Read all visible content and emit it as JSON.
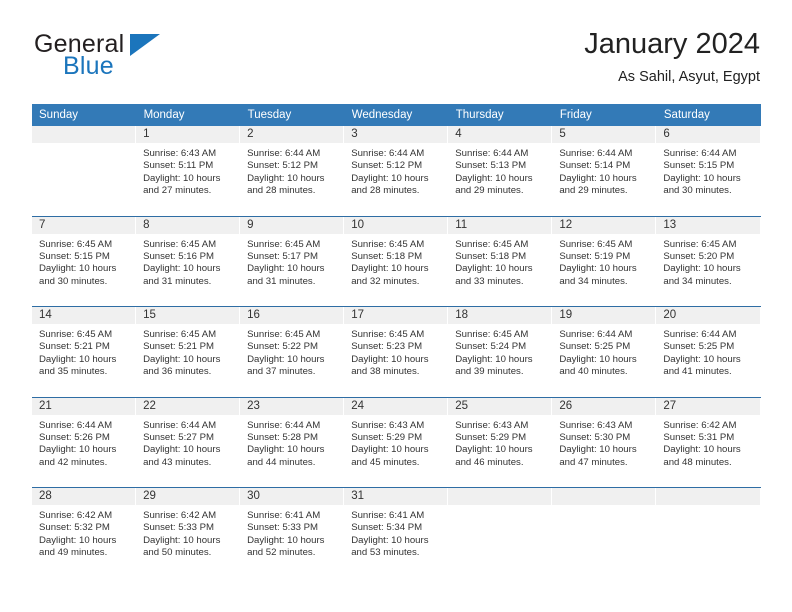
{
  "brand": {
    "name_top": "General",
    "name_bottom": "Blue",
    "accent_color": "#1b75bc"
  },
  "header": {
    "title": "January 2024",
    "subtitle": "As Sahil, Asyut, Egypt"
  },
  "theme": {
    "header_row_bg": "#337ab7",
    "daynum_bg": "#f0f0f0",
    "row_separator": "#2e6da4",
    "text_color": "#333333"
  },
  "weekday_headers": [
    "Sunday",
    "Monday",
    "Tuesday",
    "Wednesday",
    "Thursday",
    "Friday",
    "Saturday"
  ],
  "labels": {
    "sunrise_prefix": "Sunrise:",
    "sunset_prefix": "Sunset:",
    "daylight_prefix": "Daylight:"
  },
  "weeks": [
    [
      {
        "day": "",
        "empty": true
      },
      {
        "day": "1",
        "sunrise": "Sunrise: 6:43 AM",
        "sunset": "Sunset: 5:11 PM",
        "daylight": "Daylight: 10 hours and 27 minutes."
      },
      {
        "day": "2",
        "sunrise": "Sunrise: 6:44 AM",
        "sunset": "Sunset: 5:12 PM",
        "daylight": "Daylight: 10 hours and 28 minutes."
      },
      {
        "day": "3",
        "sunrise": "Sunrise: 6:44 AM",
        "sunset": "Sunset: 5:12 PM",
        "daylight": "Daylight: 10 hours and 28 minutes."
      },
      {
        "day": "4",
        "sunrise": "Sunrise: 6:44 AM",
        "sunset": "Sunset: 5:13 PM",
        "daylight": "Daylight: 10 hours and 29 minutes."
      },
      {
        "day": "5",
        "sunrise": "Sunrise: 6:44 AM",
        "sunset": "Sunset: 5:14 PM",
        "daylight": "Daylight: 10 hours and 29 minutes."
      },
      {
        "day": "6",
        "sunrise": "Sunrise: 6:44 AM",
        "sunset": "Sunset: 5:15 PM",
        "daylight": "Daylight: 10 hours and 30 minutes."
      }
    ],
    [
      {
        "day": "7",
        "sunrise": "Sunrise: 6:45 AM",
        "sunset": "Sunset: 5:15 PM",
        "daylight": "Daylight: 10 hours and 30 minutes."
      },
      {
        "day": "8",
        "sunrise": "Sunrise: 6:45 AM",
        "sunset": "Sunset: 5:16 PM",
        "daylight": "Daylight: 10 hours and 31 minutes."
      },
      {
        "day": "9",
        "sunrise": "Sunrise: 6:45 AM",
        "sunset": "Sunset: 5:17 PM",
        "daylight": "Daylight: 10 hours and 31 minutes."
      },
      {
        "day": "10",
        "sunrise": "Sunrise: 6:45 AM",
        "sunset": "Sunset: 5:18 PM",
        "daylight": "Daylight: 10 hours and 32 minutes."
      },
      {
        "day": "11",
        "sunrise": "Sunrise: 6:45 AM",
        "sunset": "Sunset: 5:18 PM",
        "daylight": "Daylight: 10 hours and 33 minutes."
      },
      {
        "day": "12",
        "sunrise": "Sunrise: 6:45 AM",
        "sunset": "Sunset: 5:19 PM",
        "daylight": "Daylight: 10 hours and 34 minutes."
      },
      {
        "day": "13",
        "sunrise": "Sunrise: 6:45 AM",
        "sunset": "Sunset: 5:20 PM",
        "daylight": "Daylight: 10 hours and 34 minutes."
      }
    ],
    [
      {
        "day": "14",
        "sunrise": "Sunrise: 6:45 AM",
        "sunset": "Sunset: 5:21 PM",
        "daylight": "Daylight: 10 hours and 35 minutes."
      },
      {
        "day": "15",
        "sunrise": "Sunrise: 6:45 AM",
        "sunset": "Sunset: 5:21 PM",
        "daylight": "Daylight: 10 hours and 36 minutes."
      },
      {
        "day": "16",
        "sunrise": "Sunrise: 6:45 AM",
        "sunset": "Sunset: 5:22 PM",
        "daylight": "Daylight: 10 hours and 37 minutes."
      },
      {
        "day": "17",
        "sunrise": "Sunrise: 6:45 AM",
        "sunset": "Sunset: 5:23 PM",
        "daylight": "Daylight: 10 hours and 38 minutes."
      },
      {
        "day": "18",
        "sunrise": "Sunrise: 6:45 AM",
        "sunset": "Sunset: 5:24 PM",
        "daylight": "Daylight: 10 hours and 39 minutes."
      },
      {
        "day": "19",
        "sunrise": "Sunrise: 6:44 AM",
        "sunset": "Sunset: 5:25 PM",
        "daylight": "Daylight: 10 hours and 40 minutes."
      },
      {
        "day": "20",
        "sunrise": "Sunrise: 6:44 AM",
        "sunset": "Sunset: 5:25 PM",
        "daylight": "Daylight: 10 hours and 41 minutes."
      }
    ],
    [
      {
        "day": "21",
        "sunrise": "Sunrise: 6:44 AM",
        "sunset": "Sunset: 5:26 PM",
        "daylight": "Daylight: 10 hours and 42 minutes."
      },
      {
        "day": "22",
        "sunrise": "Sunrise: 6:44 AM",
        "sunset": "Sunset: 5:27 PM",
        "daylight": "Daylight: 10 hours and 43 minutes."
      },
      {
        "day": "23",
        "sunrise": "Sunrise: 6:44 AM",
        "sunset": "Sunset: 5:28 PM",
        "daylight": "Daylight: 10 hours and 44 minutes."
      },
      {
        "day": "24",
        "sunrise": "Sunrise: 6:43 AM",
        "sunset": "Sunset: 5:29 PM",
        "daylight": "Daylight: 10 hours and 45 minutes."
      },
      {
        "day": "25",
        "sunrise": "Sunrise: 6:43 AM",
        "sunset": "Sunset: 5:29 PM",
        "daylight": "Daylight: 10 hours and 46 minutes."
      },
      {
        "day": "26",
        "sunrise": "Sunrise: 6:43 AM",
        "sunset": "Sunset: 5:30 PM",
        "daylight": "Daylight: 10 hours and 47 minutes."
      },
      {
        "day": "27",
        "sunrise": "Sunrise: 6:42 AM",
        "sunset": "Sunset: 5:31 PM",
        "daylight": "Daylight: 10 hours and 48 minutes."
      }
    ],
    [
      {
        "day": "28",
        "sunrise": "Sunrise: 6:42 AM",
        "sunset": "Sunset: 5:32 PM",
        "daylight": "Daylight: 10 hours and 49 minutes."
      },
      {
        "day": "29",
        "sunrise": "Sunrise: 6:42 AM",
        "sunset": "Sunset: 5:33 PM",
        "daylight": "Daylight: 10 hours and 50 minutes."
      },
      {
        "day": "30",
        "sunrise": "Sunrise: 6:41 AM",
        "sunset": "Sunset: 5:33 PM",
        "daylight": "Daylight: 10 hours and 52 minutes."
      },
      {
        "day": "31",
        "sunrise": "Sunrise: 6:41 AM",
        "sunset": "Sunset: 5:34 PM",
        "daylight": "Daylight: 10 hours and 53 minutes."
      },
      {
        "day": "",
        "empty": true
      },
      {
        "day": "",
        "empty": true
      },
      {
        "day": "",
        "empty": true
      }
    ]
  ]
}
